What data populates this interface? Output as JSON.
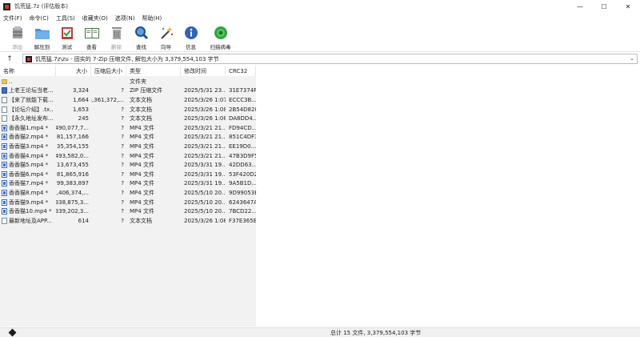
{
  "window": {
    "title": "饥荒猛.7z (评估版本)",
    "controls": [
      "—",
      "☐",
      "✕"
    ]
  },
  "menu": [
    "文件(F)",
    "命令(C)",
    "工具(S)",
    "收藏夹(O)",
    "选项(N)",
    "帮助(H)"
  ],
  "toolbar": [
    {
      "label": "添加",
      "icon": "add-icon",
      "disabled": true
    },
    {
      "label": "解压到",
      "icon": "extract-folder-icon",
      "disabled": false
    },
    {
      "label": "测试",
      "icon": "test-icon",
      "disabled": false
    },
    {
      "label": "查看",
      "icon": "view-book-icon",
      "disabled": false
    },
    {
      "label": "删除",
      "icon": "trash-icon",
      "disabled": true
    },
    {
      "label": "查找",
      "icon": "magnifier-icon",
      "disabled": false
    },
    {
      "label": "向导",
      "icon": "wizard-wand-icon",
      "disabled": false
    },
    {
      "label": "信息",
      "icon": "info-icon",
      "disabled": false
    },
    {
      "label": "扫描病毒",
      "icon": "virus-scan-icon",
      "disabled": false
    }
  ],
  "address": {
    "up_glyph": "↑",
    "path": "饥荒猛.7z\\zu - 固实的 7-Zip 压缩文件, 解包大小为 3,379,554,103 字节",
    "dropdown_glyph": "⌄"
  },
  "columns": {
    "name": "名称",
    "size": "大小",
    "packed": "压缩后大小",
    "type": "类型",
    "modified": "修改时间",
    "crc": "CRC32"
  },
  "files": [
    {
      "name": "..",
      "size": "",
      "packed": "",
      "type": "文件夹",
      "modified": "",
      "crc": "",
      "kind": "folder"
    },
    {
      "name": "上老王论坛当老...",
      "size": "3,324",
      "packed": "?",
      "type": "ZIP 压缩文件",
      "modified": "2025/5/31 23...",
      "crc": "31E7374F",
      "kind": "zip"
    },
    {
      "name": "【来了就能下载...",
      "size": "1,664",
      "packed": "3,361,372,...",
      "type": "文本文档",
      "modified": "2025/3/26 1:07",
      "crc": "ECCC3B...",
      "kind": "txt"
    },
    {
      "name": "【论坛介绍】.tx...",
      "size": "1,653",
      "packed": "?",
      "type": "文本文档",
      "modified": "2025/3/26 1:08",
      "crc": "2B54D820",
      "kind": "txt"
    },
    {
      "name": "【永久地址发布...",
      "size": "245",
      "packed": "?",
      "type": "文本文档",
      "modified": "2025/3/26 1:08",
      "crc": "DA8DD4...",
      "kind": "txt"
    },
    {
      "name": "香香猫1.mp4 *",
      "size": "490,077,7...",
      "packed": "?",
      "type": "MP4 文件",
      "modified": "2025/3/21 21...",
      "crc": "FD94CD...",
      "kind": "mp4"
    },
    {
      "name": "香香猫2.mp4 *",
      "size": "81,157,166",
      "packed": "?",
      "type": "MP4 文件",
      "modified": "2025/3/21 21...",
      "crc": "851C4DF3",
      "kind": "mp4"
    },
    {
      "name": "香香猫3.mp4 *",
      "size": "35,354,155",
      "packed": "?",
      "type": "MP4 文件",
      "modified": "2025/3/21 21...",
      "crc": "EE19D0...",
      "kind": "mp4"
    },
    {
      "name": "香香猫4.mp4 *",
      "size": "493,582,0...",
      "packed": "?",
      "type": "MP4 文件",
      "modified": "2025/3/21 21...",
      "crc": "47B3D9F5",
      "kind": "mp4"
    },
    {
      "name": "香香猫5.mp4 *",
      "size": "13,673,455",
      "packed": "?",
      "type": "MP4 文件",
      "modified": "2025/3/31 19...",
      "crc": "42DD63...",
      "kind": "mp4"
    },
    {
      "name": "香香猫6.mp4 *",
      "size": "81,865,916",
      "packed": "?",
      "type": "MP4 文件",
      "modified": "2025/3/31 19...",
      "crc": "53F420D2",
      "kind": "mp4"
    },
    {
      "name": "香香猫7.mp4 *",
      "size": "99,383,897",
      "packed": "?",
      "type": "MP4 文件",
      "modified": "2025/3/31 19...",
      "crc": "9A5B1D...",
      "kind": "mp4"
    },
    {
      "name": "香香猫8.mp4 *",
      "size": "1,406,374,...",
      "packed": "?",
      "type": "MP4 文件",
      "modified": "2025/5/10 20...",
      "crc": "9D99053E",
      "kind": "mp4"
    },
    {
      "name": "香香猫9.mp4 *",
      "size": "338,875,3...",
      "packed": "?",
      "type": "MP4 文件",
      "modified": "2025/5/10 20...",
      "crc": "6243647A",
      "kind": "mp4"
    },
    {
      "name": "香香猫10.mp4 *",
      "size": "339,202,3...",
      "packed": "?",
      "type": "MP4 文件",
      "modified": "2025/5/10 20...",
      "crc": "7BCD22...",
      "kind": "mp4"
    },
    {
      "name": "最新地址及APP...",
      "size": "614",
      "packed": "?",
      "type": "文本文档",
      "modified": "2025/3/26 1:08",
      "crc": "F37E365B",
      "kind": "txt"
    }
  ],
  "status": {
    "text": "总计 15 文件, 3,379,554,103 字节"
  },
  "colors": {
    "accent_red": "#d2352a",
    "folder": "#e8c45a",
    "list_bg": "#f2f2f2"
  }
}
